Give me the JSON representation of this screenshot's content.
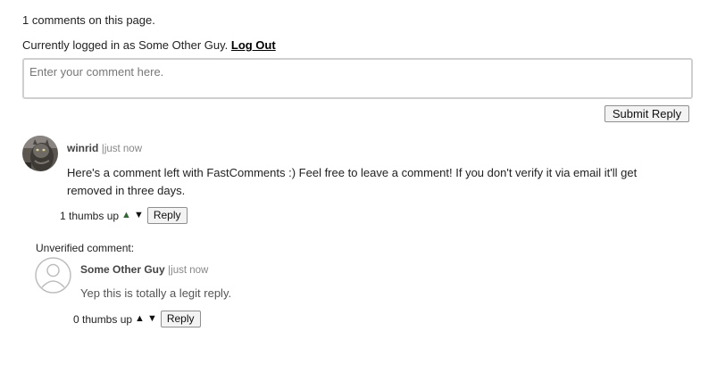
{
  "header": {
    "comment_count": "1 comments on this page.",
    "logged_in_prefix": "Currently logged in as Some Other Guy. ",
    "logout_label": "Log Out"
  },
  "composer": {
    "placeholder": "Enter your comment here.",
    "submit_label": "Submit Reply"
  },
  "comments": [
    {
      "author": "winrid",
      "separator": "|",
      "timestamp": "just now",
      "text": "Here's a comment left with FastComments :) Feel free to leave a comment! If you don't verify it via email it'll get removed in three days.",
      "votes": "1 thumbs up",
      "up_icon": "triangle-up-icon",
      "down_icon": "triangle-down-icon",
      "reply_label": "Reply",
      "avatar_icon": "user-photo-avatar",
      "up_vote_color": "#2e6b2e"
    },
    {
      "label": "Unverified comment:",
      "author": "Some Other Guy",
      "separator": "|",
      "timestamp": "just now",
      "text": "Yep this is totally a legit reply.",
      "votes": "0 thumbs up",
      "up_icon": "triangle-up-icon",
      "down_icon": "triangle-down-icon",
      "reply_label": "Reply",
      "avatar_icon": "default-user-avatar-icon"
    }
  ],
  "glyphs": {
    "up": "▲",
    "down": "▼"
  }
}
